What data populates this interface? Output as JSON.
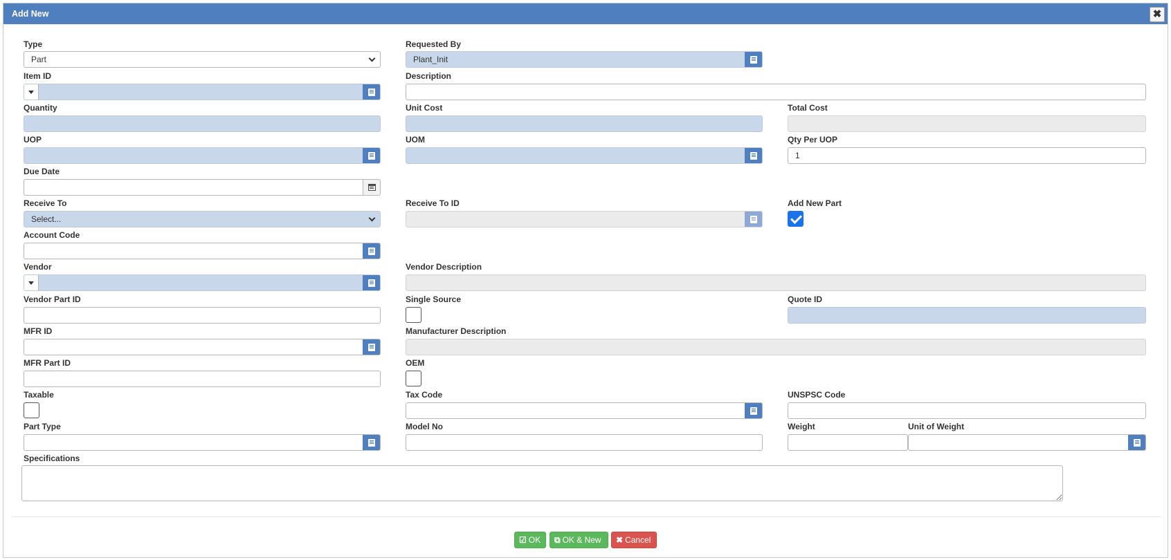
{
  "dialog": {
    "title": "Add New",
    "close_glyph": "✖"
  },
  "form": {
    "type": {
      "label": "Type",
      "value": "Part"
    },
    "requested_by": {
      "label": "Requested By",
      "value": "Plant_Init"
    },
    "item_id": {
      "label": "Item ID",
      "value": ""
    },
    "description": {
      "label": "Description",
      "value": ""
    },
    "quantity": {
      "label": "Quantity",
      "value": ""
    },
    "unit_cost": {
      "label": "Unit Cost",
      "value": ""
    },
    "total_cost": {
      "label": "Total Cost",
      "value": ""
    },
    "uop": {
      "label": "UOP",
      "value": ""
    },
    "uom": {
      "label": "UOM",
      "value": ""
    },
    "qty_per_uop": {
      "label": "Qty Per UOP",
      "value": "1"
    },
    "due_date": {
      "label": "Due Date",
      "value": ""
    },
    "receive_to": {
      "label": "Receive To",
      "value": "Select..."
    },
    "receive_to_id": {
      "label": "Receive To ID",
      "value": ""
    },
    "add_new_part": {
      "label": "Add New Part",
      "checked": true
    },
    "account_code": {
      "label": "Account Code",
      "value": ""
    },
    "vendor": {
      "label": "Vendor",
      "value": ""
    },
    "vendor_description": {
      "label": "Vendor Description",
      "value": ""
    },
    "vendor_part_id": {
      "label": "Vendor Part ID",
      "value": ""
    },
    "single_source": {
      "label": "Single Source",
      "checked": false
    },
    "quote_id": {
      "label": "Quote ID",
      "value": ""
    },
    "mfr_id": {
      "label": "MFR ID",
      "value": ""
    },
    "manufacturer_description": {
      "label": "Manufacturer Description",
      "value": ""
    },
    "mfr_part_id": {
      "label": "MFR Part ID",
      "value": ""
    },
    "oem": {
      "label": "OEM",
      "checked": false
    },
    "taxable": {
      "label": "Taxable",
      "checked": false
    },
    "tax_code": {
      "label": "Tax Code",
      "value": ""
    },
    "unspsc_code": {
      "label": "UNSPSC Code",
      "value": ""
    },
    "part_type": {
      "label": "Part Type",
      "value": ""
    },
    "model_no": {
      "label": "Model No",
      "value": ""
    },
    "weight": {
      "label": "Weight",
      "value": ""
    },
    "unit_of_weight": {
      "label": "Unit of Weight",
      "value": ""
    },
    "specifications": {
      "label": "Specifications",
      "value": ""
    }
  },
  "buttons": {
    "ok": {
      "icon": "☑",
      "label": "OK"
    },
    "ok_new": {
      "icon": "⧉",
      "label": "OK & New"
    },
    "cancel": {
      "icon": "✖",
      "label": "Cancel"
    }
  },
  "colors": {
    "header": "#4f7fbf",
    "readonly_blue": "#c9d7ea",
    "readonly_gray": "#ebebeb",
    "ok_green": "#5cb85c",
    "cancel_red": "#d9534f",
    "checkbox_blue": "#1a73e8"
  }
}
